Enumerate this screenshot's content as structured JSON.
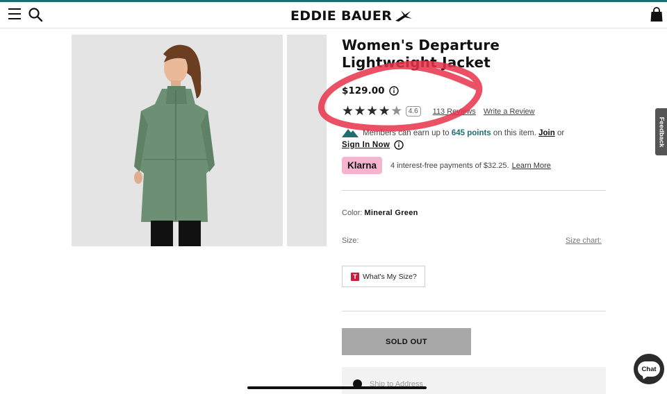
{
  "header": {
    "brand": "EDDIE BAUER",
    "icons": {
      "menu": "hamburger-menu-icon",
      "search": "search-icon",
      "bag": "shopping-bag-icon"
    },
    "accent_color": "#1f6f72"
  },
  "product": {
    "title": "Women's Departure Lightweight Jacket",
    "price": "$129.00",
    "rating": {
      "value": "4.6",
      "stars_filled": 4,
      "stars_total": 5,
      "reviews": "113 Reviews",
      "write_review": "Write a Review"
    },
    "members": {
      "text_before": "Members can earn up to ",
      "points": "645 points",
      "text_after": " on this item. ",
      "join": "Join",
      "or": " or",
      "sign_in": "Sign In Now"
    },
    "klarna": {
      "badge": "Klarna",
      "text": "4 interest-free payments of $32.25.",
      "learn_more": "Learn More",
      "badge_color": "#f6b4cf"
    },
    "color": {
      "label": "Color:",
      "value": "Mineral Green"
    },
    "size": {
      "label": "Size:",
      "chart_link": "Size chart:"
    },
    "whats_my_size": {
      "badge": "T",
      "label": "What's My Size?"
    },
    "sold_out": "SOLD OUT",
    "ship_option": "Ship to Address"
  },
  "side": {
    "feedback": "Feedback",
    "chat": "Chat"
  }
}
